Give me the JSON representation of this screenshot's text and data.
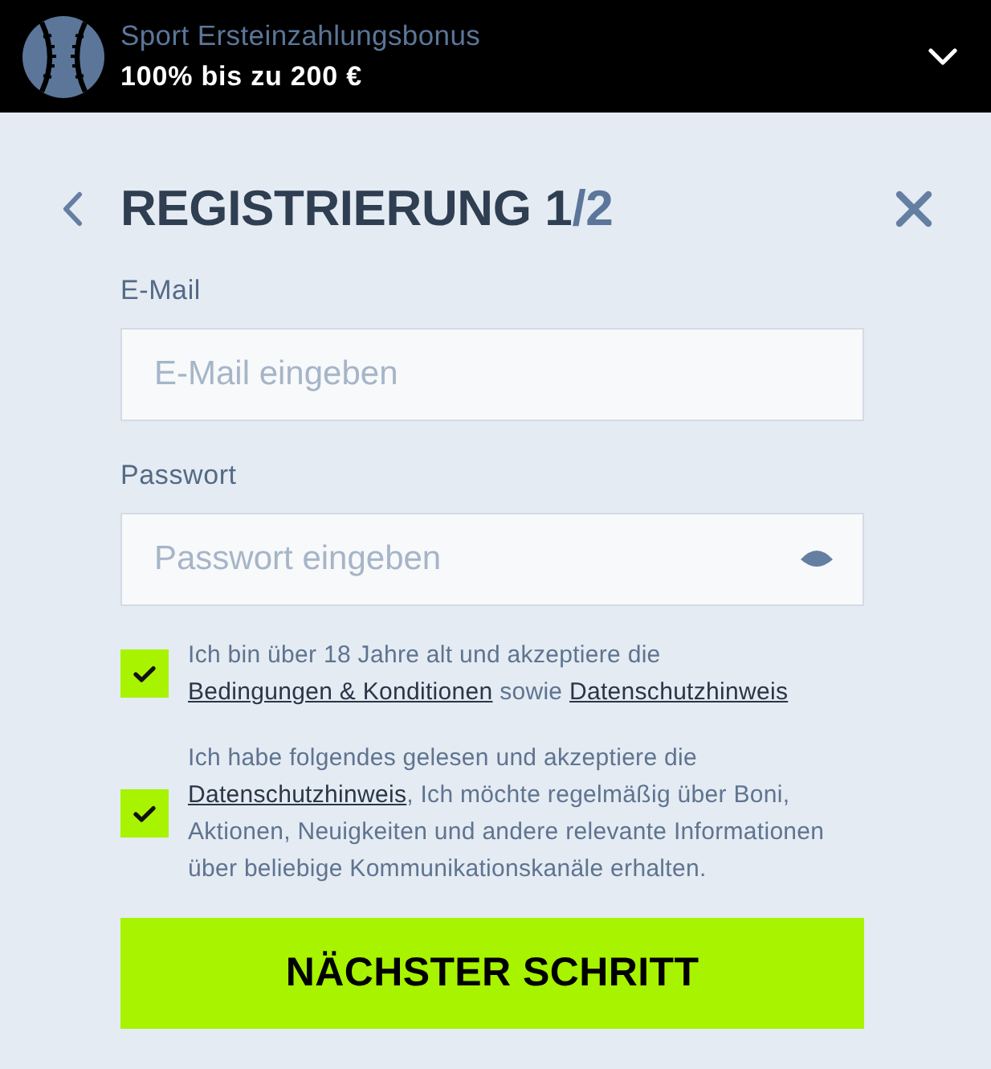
{
  "promo_banner": {
    "title": "Sport Ersteinzahlungsbonus",
    "offer": "100% bis zu 200 €",
    "expanded": false
  },
  "header": {
    "title": "REGISTRIERUNG 1",
    "step_total": "/2"
  },
  "fields": [
    {
      "kind": "email",
      "label": "E-Mail",
      "placeholder": "E-Mail eingeben"
    },
    {
      "kind": "password",
      "label": "Passwort",
      "placeholder": "Passwort eingeben"
    }
  ],
  "consents": [
    {
      "checked": true,
      "segments": [
        {
          "kind": "text",
          "text": "Ich bin über 18 Jahre alt und akzeptiere die "
        },
        {
          "kind": "link",
          "text": "Bedingungen & Konditionen"
        },
        {
          "kind": "text",
          "text": " sowie "
        },
        {
          "kind": "link",
          "text": "Datenschutzhinweis"
        }
      ]
    },
    {
      "checked": true,
      "segments": [
        {
          "kind": "text",
          "text": "Ich habe folgendes gelesen und akzeptiere die "
        },
        {
          "kind": "link",
          "text": "Datenschutzhinweis"
        },
        {
          "kind": "text",
          "text": ", Ich möchte regelmäßig über Boni, Aktionen, Neuigkeiten und andere relevante Informationen über beliebige Kommunikationskanäle erhalten."
        }
      ]
    }
  ],
  "submit_button": "NÄCHSTER SCHRITT"
}
